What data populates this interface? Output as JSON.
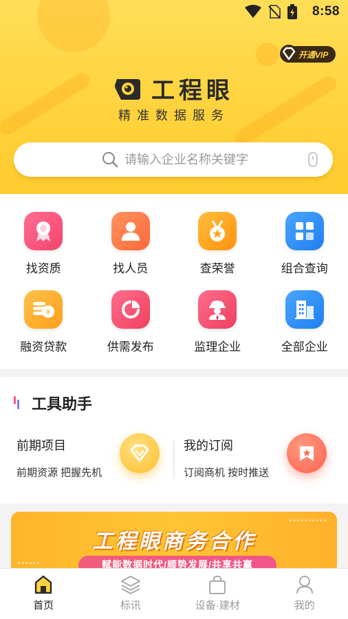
{
  "status_bar": {
    "time": "8:58"
  },
  "header": {
    "vip_label": "开通VIP",
    "app_name": "工程眼",
    "slogan": "精准数据服务",
    "search_placeholder": "请输入企业名称关键字"
  },
  "grid": [
    {
      "label": "找资质",
      "icon": "award-icon",
      "color": "#f4557a"
    },
    {
      "label": "找人员",
      "icon": "person-icon",
      "color": "#ff7a4a"
    },
    {
      "label": "查荣誉",
      "icon": "medal-icon",
      "color": "#ffa51f"
    },
    {
      "label": "组合查询",
      "icon": "grid-icon",
      "color": "#2f8ff5"
    },
    {
      "label": "融资贷款",
      "icon": "coins-icon",
      "color": "#ffb02e"
    },
    {
      "label": "供需发布",
      "icon": "pie-chart-icon",
      "color": "#f45773"
    },
    {
      "label": "监理企业",
      "icon": "supervisor-icon",
      "color": "#f45772"
    },
    {
      "label": "全部企业",
      "icon": "buildings-icon",
      "color": "#2e8cf3"
    }
  ],
  "tools": {
    "title": "工具助手",
    "cards": [
      {
        "title": "前期项目",
        "subtitle": "前期资源 把握先机",
        "icon": "diamond-icon",
        "color": "#ffc23a"
      },
      {
        "title": "我的订阅",
        "subtitle": "订阅商机 按时推送",
        "icon": "bookmark-star-icon",
        "color": "#ff6f5a"
      }
    ]
  },
  "banner": {
    "title": "工程眼商务合作",
    "subtitle": "赋能数据时代/顺势发展/共享共赢"
  },
  "bottom_nav": [
    {
      "label": "首页",
      "icon": "home-icon",
      "active": true
    },
    {
      "label": "标讯",
      "icon": "layers-icon",
      "active": false
    },
    {
      "label": "设备·建材",
      "icon": "bag-icon",
      "active": false
    },
    {
      "label": "我的",
      "icon": "profile-icon",
      "active": false
    }
  ],
  "colors": {
    "brand_yellow": "#ffd23c",
    "accent_dark": "#2b2b2b"
  }
}
